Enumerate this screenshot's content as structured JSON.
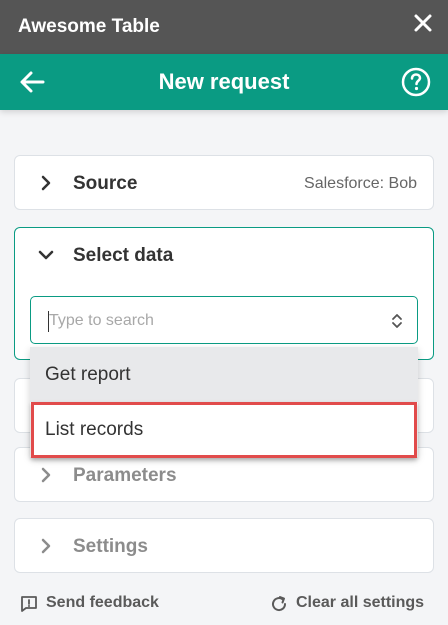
{
  "window": {
    "title": "Awesome Table"
  },
  "header": {
    "title": "New request"
  },
  "sections": {
    "source": {
      "title": "Source",
      "value": "Salesforce: Bob"
    },
    "select_data": {
      "title": "Select data",
      "search_placeholder": "Type to search"
    },
    "parameters": {
      "title": "Parameters"
    },
    "settings": {
      "title": "Settings"
    }
  },
  "dropdown": {
    "options": [
      "Get report",
      "List records"
    ],
    "highlighted_index": 1
  },
  "footer": {
    "feedback": "Send feedback",
    "clear": "Clear all settings"
  },
  "colors": {
    "accent": "#0a9b83",
    "titlebar": "#555555",
    "highlight": "#e14b4b"
  },
  "icons": [
    "close-icon",
    "back-arrow-icon",
    "help-icon",
    "chevron-right-icon",
    "chevron-down-icon",
    "updown-icon",
    "feedback-icon",
    "refresh-icon"
  ]
}
